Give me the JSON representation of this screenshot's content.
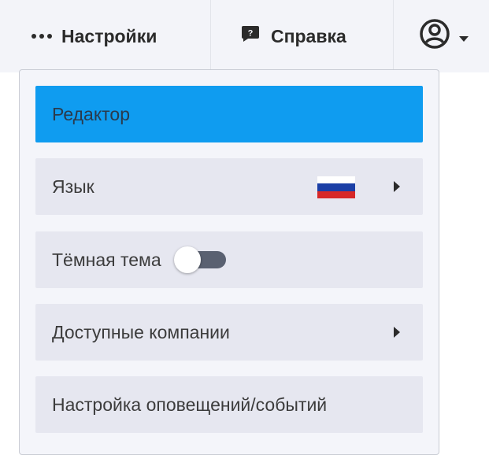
{
  "navbar": {
    "settings_label": "Настройки",
    "help_label": "Справка",
    "icons": {
      "settings": "more-horizontal-icon",
      "help": "help-bubble-icon",
      "user": "user-circle-icon",
      "user_menu": "caret-down-icon"
    }
  },
  "dropdown": {
    "items": [
      {
        "label": "Редактор",
        "active": true
      },
      {
        "label": "Язык",
        "flag": "russian-flag-icon",
        "submenu": true
      },
      {
        "label": "Тёмная тема",
        "toggle_on": false
      },
      {
        "label": "Доступные компании",
        "submenu": true
      },
      {
        "label": "Настройка оповещений/событий"
      }
    ]
  },
  "colors": {
    "active_item": "#0f9cf0",
    "item_background": "#e6e7f0",
    "navbar_background": "#f3f4f9",
    "toggle_track": "#5a6171",
    "flag_white": "#ffffff",
    "flag_blue": "#1b3fa6",
    "flag_red": "#d72828"
  }
}
